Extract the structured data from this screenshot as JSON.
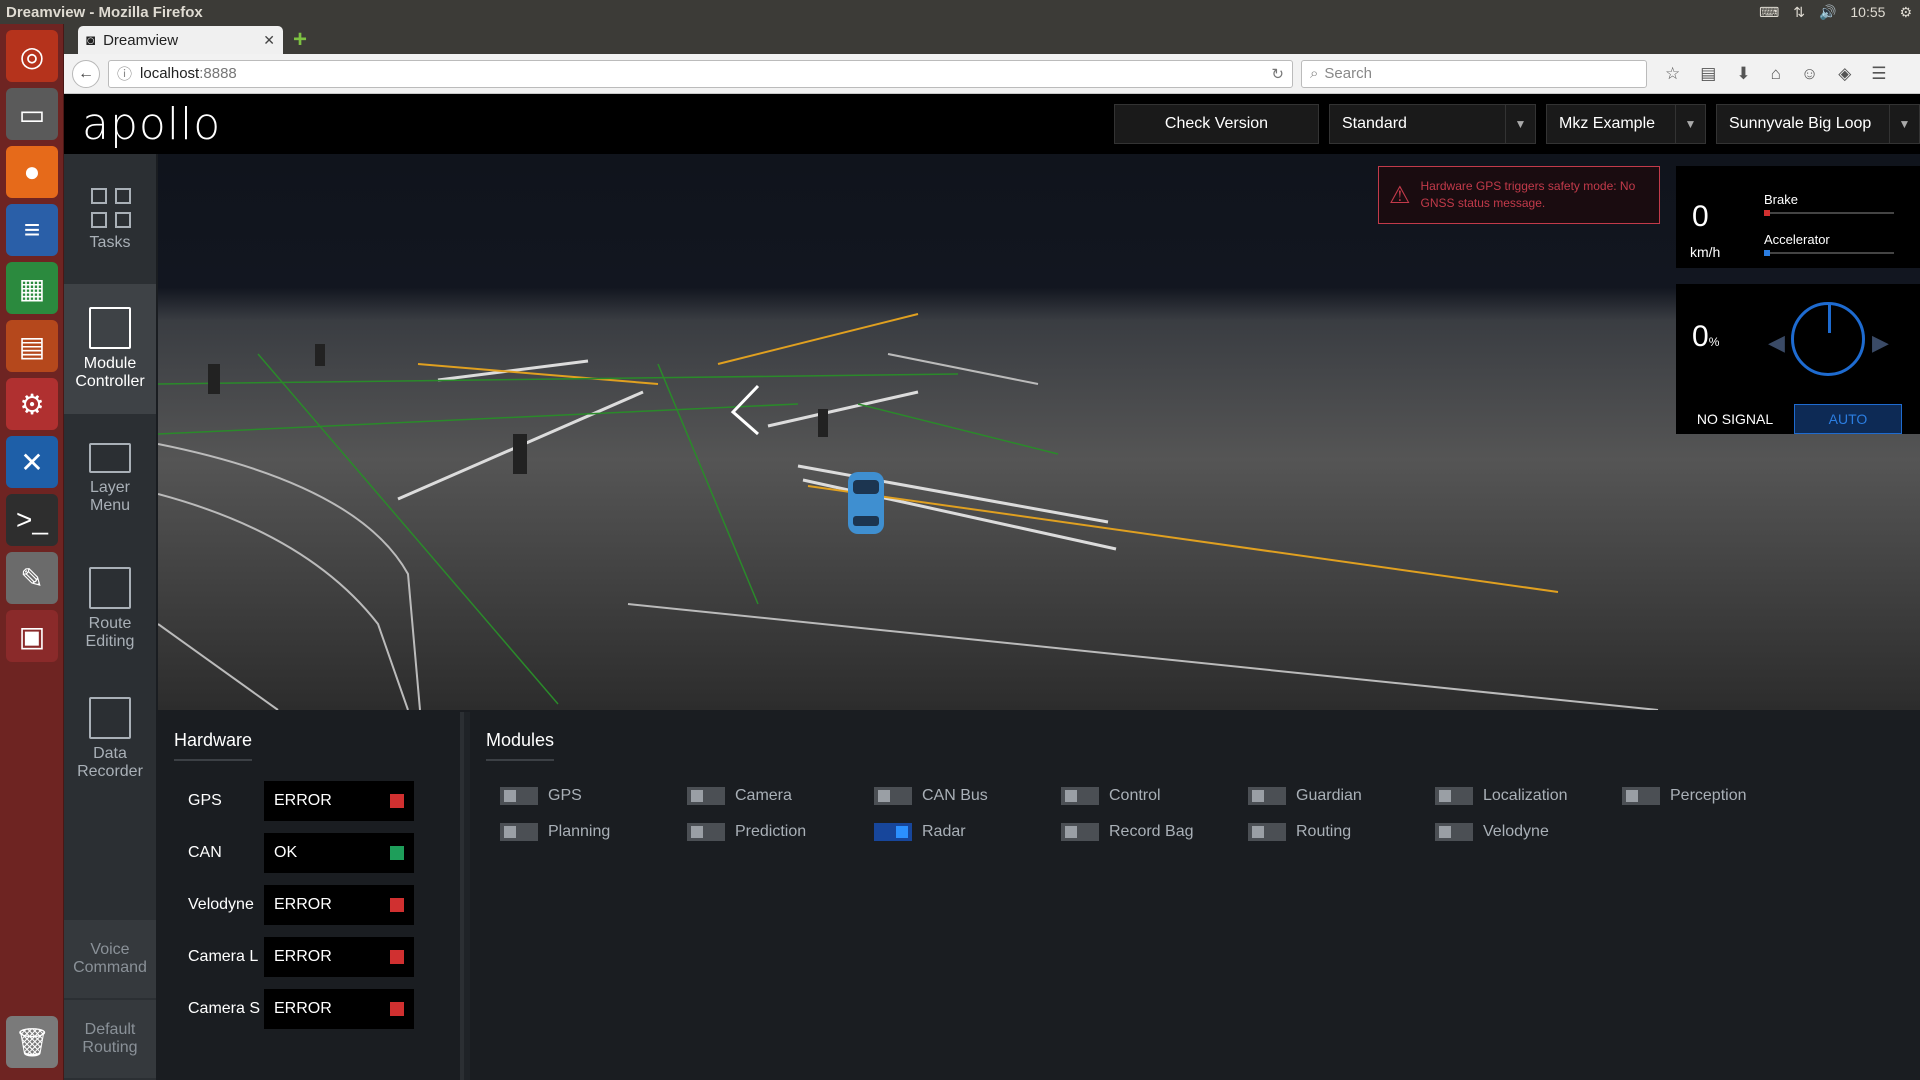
{
  "window_title": "Dreamview - Mozilla Firefox",
  "clock": "10:55",
  "browser": {
    "tab_title": "Dreamview",
    "url_host": "localhost",
    "url_port": ":8888",
    "search_placeholder": "Search"
  },
  "app": {
    "logo": "apollo",
    "check_version": "Check Version",
    "mode": "Standard",
    "vehicle": "Mkz Example",
    "map": "Sunnyvale Big Loop"
  },
  "sidenav": {
    "items": [
      {
        "label": "Tasks"
      },
      {
        "label": "Module Controller"
      },
      {
        "label": "Layer Menu"
      },
      {
        "label": "Route Editing"
      },
      {
        "label": "Data Recorder"
      }
    ],
    "voice_command": "Voice Command",
    "default_routing": "Default Routing"
  },
  "alert": {
    "message": "Hardware GPS triggers safety mode: No GNSS status message."
  },
  "dashboard": {
    "speed": "0",
    "speed_unit": "km/h",
    "brake_label": "Brake",
    "accelerator_label": "Accelerator",
    "steering_pct": "0",
    "pct_sign": "%",
    "signal": "NO SIGNAL",
    "driving_mode": "AUTO",
    "colors": {
      "brake": "#d03030",
      "accelerator": "#2b7de0"
    }
  },
  "hardware": {
    "title": "Hardware",
    "items": [
      {
        "name": "GPS",
        "status": "ERROR",
        "color": "#d03030"
      },
      {
        "name": "CAN",
        "status": "OK",
        "color": "#1e9e5a"
      },
      {
        "name": "Velodyne",
        "status": "ERROR",
        "color": "#d03030"
      },
      {
        "name": "Camera L",
        "status": "ERROR",
        "color": "#d03030"
      },
      {
        "name": "Camera S",
        "status": "ERROR",
        "color": "#d03030"
      }
    ]
  },
  "modules": {
    "title": "Modules",
    "items": [
      {
        "name": "GPS",
        "on": false
      },
      {
        "name": "Camera",
        "on": false
      },
      {
        "name": "CAN Bus",
        "on": false
      },
      {
        "name": "Control",
        "on": false
      },
      {
        "name": "Guardian",
        "on": false
      },
      {
        "name": "Localization",
        "on": false
      },
      {
        "name": "Perception",
        "on": false
      },
      {
        "name": "Planning",
        "on": false
      },
      {
        "name": "Prediction",
        "on": false
      },
      {
        "name": "Radar",
        "on": true
      },
      {
        "name": "Record Bag",
        "on": false
      },
      {
        "name": "Routing",
        "on": false
      },
      {
        "name": "Velodyne",
        "on": false
      }
    ]
  }
}
